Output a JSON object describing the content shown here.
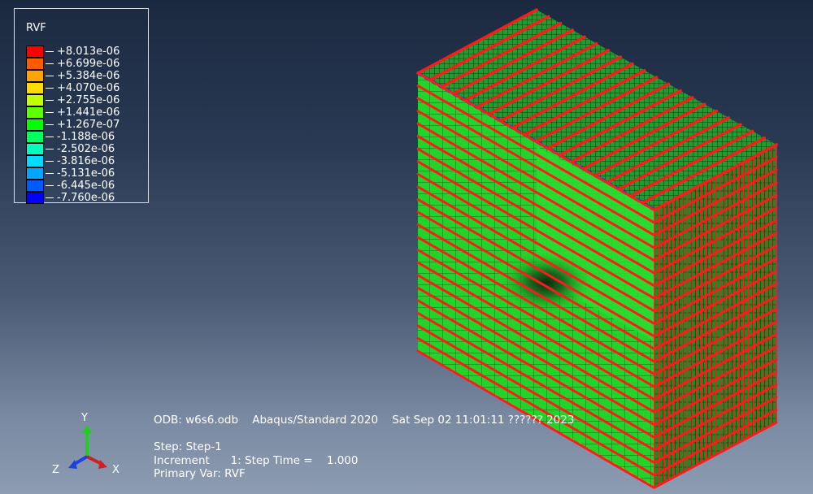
{
  "legend": {
    "title": "RVF",
    "entries": [
      {
        "value": "+8.013e-06",
        "color": "#ff0000"
      },
      {
        "value": "+6.699e-06",
        "color": "#ff5a00"
      },
      {
        "value": "+5.384e-06",
        "color": "#ffa500"
      },
      {
        "value": "+4.070e-06",
        "color": "#ffdc00"
      },
      {
        "value": "+2.755e-06",
        "color": "#bfff00"
      },
      {
        "value": "+1.441e-06",
        "color": "#60ff00"
      },
      {
        "value": "+1.267e-07",
        "color": "#00ff00"
      },
      {
        "value": "-1.188e-06",
        "color": "#00ff60"
      },
      {
        "value": "-2.502e-06",
        "color": "#00ffbf"
      },
      {
        "value": "-3.816e-06",
        "color": "#00dcff"
      },
      {
        "value": "-5.131e-06",
        "color": "#00a5ff"
      },
      {
        "value": "-6.445e-06",
        "color": "#005aff"
      },
      {
        "value": "-7.760e-06",
        "color": "#0000ff"
      }
    ]
  },
  "info": {
    "odb_line": "ODB: w6s6.odb    Abaqus/Standard 2020    Sat Sep 02 11:01:11 ?????? 2023",
    "step_line": "Step: Step-1",
    "increment_line": "Increment      1: Step Time =    1.000",
    "primary_var_line": "Primary Var: RVF"
  },
  "triad": {
    "x_label": "X",
    "y_label": "Y",
    "z_label": "Z"
  },
  "colors": {
    "mesh_green": "#22d32a",
    "rebar_red": "#ff1a1a",
    "mesh_line": "#0a3a0a"
  }
}
